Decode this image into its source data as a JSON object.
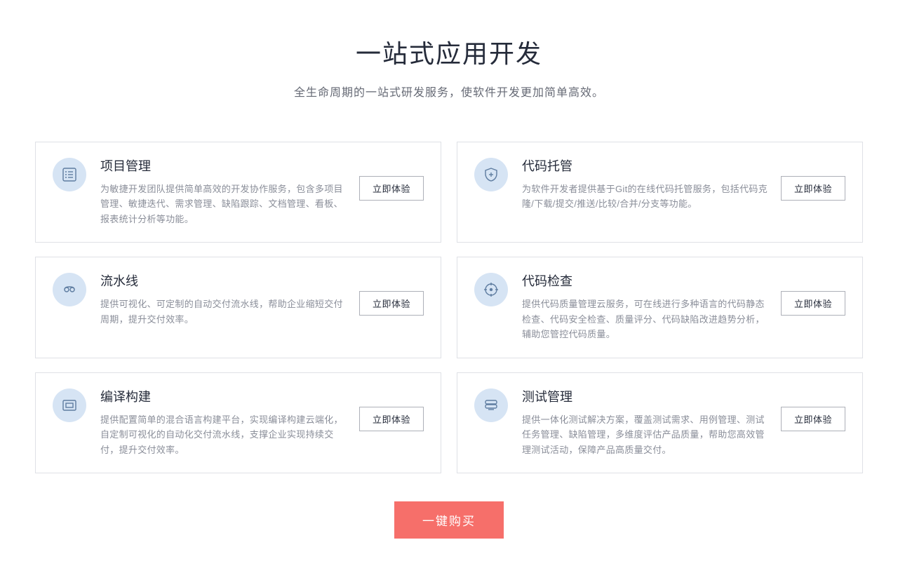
{
  "hero": {
    "title": "一站式应用开发",
    "subtitle": "全生命周期的一站式研发服务，使软件开发更加简单高效。"
  },
  "common": {
    "try_label": "立即体验"
  },
  "cards": [
    {
      "title": "项目管理",
      "desc": "为敏捷开发团队提供简单高效的开发协作服务，包含多项目管理、敏捷迭代、需求管理、缺陷跟踪、文档管理、看板、报表统计分析等功能。"
    },
    {
      "title": "代码托管",
      "desc": "为软件开发者提供基于Git的在线代码托管服务，包括代码克隆/下载/提交/推送/比较/合并/分支等功能。"
    },
    {
      "title": "流水线",
      "desc": "提供可视化、可定制的自动交付流水线，帮助企业缩短交付周期，提升交付效率。"
    },
    {
      "title": "代码检查",
      "desc": "提供代码质量管理云服务，可在线进行多种语言的代码静态检查、代码安全检查、质量评分、代码缺陷改进趋势分析，辅助您管控代码质量。"
    },
    {
      "title": "编译构建",
      "desc": "提供配置简单的混合语言构建平台，实现编译构建云端化，自定制可视化的自动化交付流水线，支撑企业实现持续交付，提升交付效率。"
    },
    {
      "title": "测试管理",
      "desc": "提供一体化测试解决方案，覆盖测试需求、用例管理、测试任务管理、缺陷管理，多维度评估产品质量，帮助您高效管理测试活动，保障产品高质量交付。"
    }
  ],
  "cta": {
    "buy_label": "一键购买"
  }
}
